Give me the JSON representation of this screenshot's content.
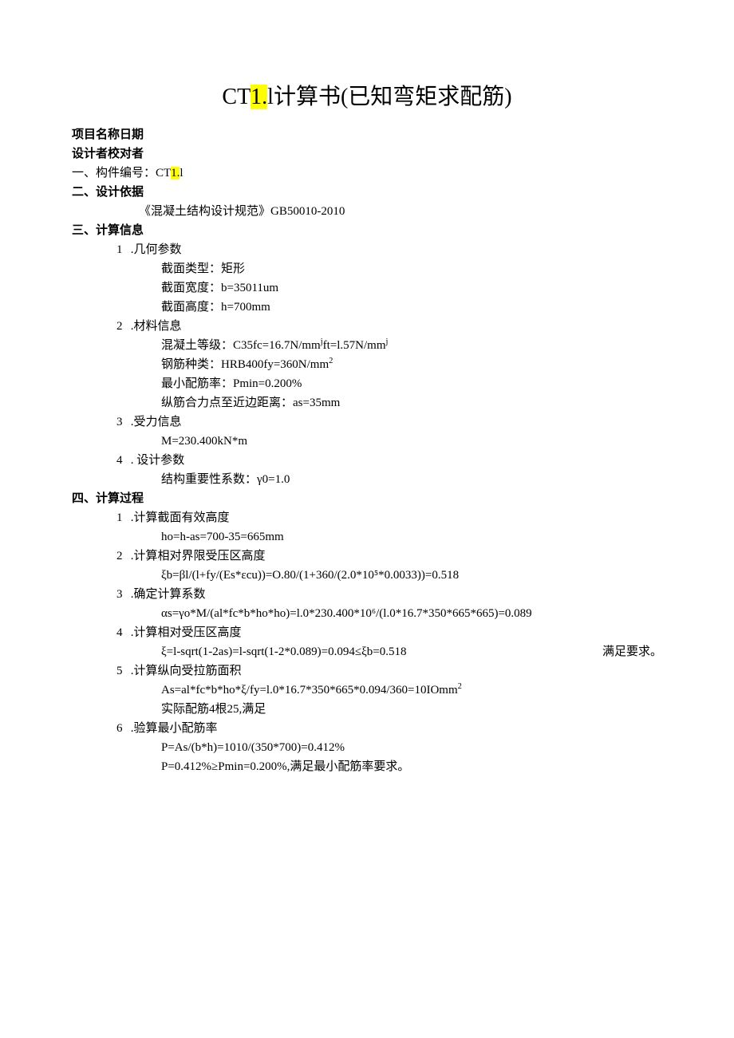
{
  "title_prefix": "CT",
  "title_hl": "1.",
  "title_suffix": "l计算书(已知弯矩求配筋)",
  "header_line1": "项目名称日期",
  "header_line2": "设计者校对者",
  "sec1": {
    "label": "一、构件编号：CT",
    "hl": "1.",
    "tail": "l"
  },
  "sec2": {
    "label": "二、设计依据",
    "item": "《混凝土结构设计规范》GB50010-2010"
  },
  "sec3": {
    "label": "三、计算信息",
    "i1": {
      "n": "1",
      "t": ".几何参数",
      "a": "截面类型：矩形",
      "b": "截面宽度：b=35011um",
      "c": "截面高度：h=700mm"
    },
    "i2": {
      "n": "2",
      "t": ".材料信息",
      "a_pre": "混凝土等级：C35fc=16.7N/mm",
      "a_mid": "ft=l.57N/mm",
      "b": "钢筋种类：HRB400fy=360N/mm",
      "c": "最小配筋率：Pmin=0.200%",
      "d": "纵筋合力点至近边距离：as=35mm"
    },
    "i3": {
      "n": "3",
      "t": ".受力信息",
      "a": "M=230.400kN*m"
    },
    "i4": {
      "n": "4",
      "t": ". 设计参数",
      "a": "结构重要性系数：γ0=1.0"
    }
  },
  "sec4": {
    "label": "四、计算过程",
    "i1": {
      "n": "1",
      "t": ".计算截面有效高度",
      "a": "ho=h-as=700-35=665mm"
    },
    "i2": {
      "n": "2",
      "t": ".计算相对界限受压区高度",
      "a": "ξb=βl/(l+fy/(Es*εcu))=O.80/(1+360/(2.0*10⁵*0.0033))=0.518"
    },
    "i3": {
      "n": "3",
      "t": ".确定计算系数",
      "a": "αs=γo*M/(al*fc*b*ho*ho)=l.0*230.400*10⁶/(l.0*16.7*350*665*665)=0.089"
    },
    "i4": {
      "n": "4",
      "t": ".计算相对受压区高度",
      "a": "ξ=l-sqrt(1-2as)=l-sqrt(1-2*0.089)=0.094≤ξb=0.518",
      "r": "满足要求。"
    },
    "i5": {
      "n": "5",
      "t": ".计算纵向受拉筋面积",
      "a": "As=al*fc*b*ho*ξ/fy=l.0*16.7*350*665*0.094/360=10IOmm",
      "b": "实际配筋4根25,满足"
    },
    "i6": {
      "n": "6",
      "t": ".验算最小配筋率",
      "a": "P=As/(b*h)=1010/(350*700)=0.412%",
      "b": "P=0.412%≥Pmin=0.200%,满足最小配筋率要求。"
    }
  }
}
